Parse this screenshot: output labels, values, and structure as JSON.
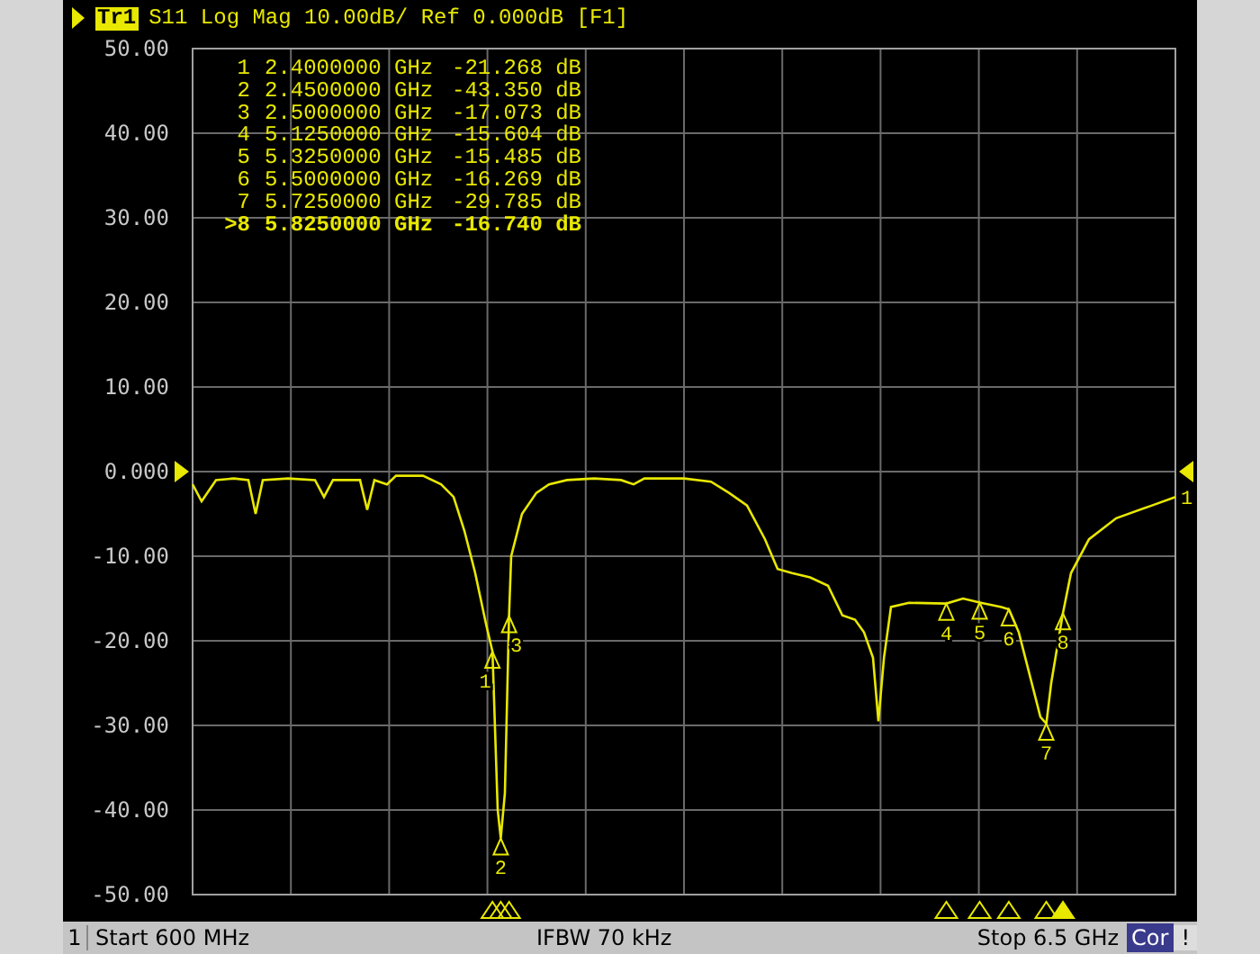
{
  "header": {
    "trace": "Tr1",
    "title": "S11 Log Mag 10.00dB/ Ref 0.000dB [F1]"
  },
  "markers": [
    {
      "number": "1",
      "frequency": "2.4000000 GHz",
      "value": "-21.268 dB",
      "selected": false
    },
    {
      "number": "2",
      "frequency": "2.4500000 GHz",
      "value": "-43.350 dB",
      "selected": false
    },
    {
      "number": "3",
      "frequency": "2.5000000 GHz",
      "value": "-17.073 dB",
      "selected": false
    },
    {
      "number": "4",
      "frequency": "5.1250000 GHz",
      "value": "-15.604 dB",
      "selected": false
    },
    {
      "number": "5",
      "frequency": "5.3250000 GHz",
      "value": "-15.485 dB",
      "selected": false
    },
    {
      "number": "6",
      "frequency": "5.5000000 GHz",
      "value": "-16.269 dB",
      "selected": false
    },
    {
      "number": "7",
      "frequency": "5.7250000 GHz",
      "value": "-29.785 dB",
      "selected": false
    },
    {
      "number": ">8",
      "frequency": "5.8250000 GHz",
      "value": "-16.740 dB",
      "selected": true
    }
  ],
  "y_axis_labels": [
    "50.00",
    "40.00",
    "30.00",
    "20.00",
    "10.00",
    "0.000",
    "-10.00",
    "-20.00",
    "-30.00",
    "-40.00",
    "-50.00"
  ],
  "trace_markers": [
    {
      "label": "1",
      "selected": false
    },
    {
      "label": "2",
      "selected": false
    },
    {
      "label": "3",
      "selected": false
    },
    {
      "label": "4",
      "selected": false
    },
    {
      "label": "5",
      "selected": false
    },
    {
      "label": "6",
      "selected": false
    },
    {
      "label": "7",
      "selected": false
    },
    {
      "label": "8",
      "selected": true
    }
  ],
  "trace_end_label": "1",
  "status_bar": {
    "channel": "1",
    "start": "Start 600 MHz",
    "ifbw": "IFBW 70 kHz",
    "stop": "Stop 6.5 GHz",
    "correction": "Cor",
    "alert": "!"
  }
}
